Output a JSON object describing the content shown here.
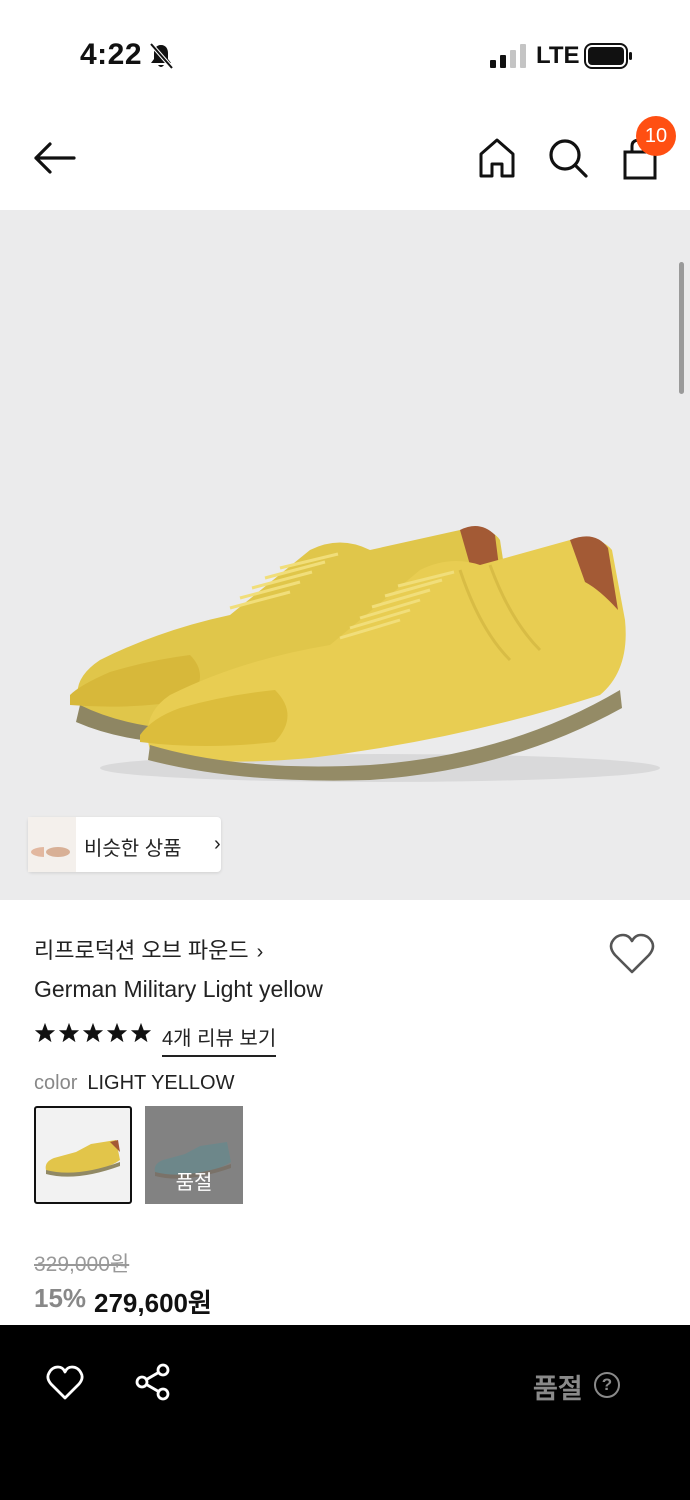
{
  "status_bar": {
    "time": "4:22",
    "network": "LTE",
    "icons": [
      "bell-off-icon",
      "signal-icon",
      "battery-icon"
    ]
  },
  "header": {
    "icons": [
      "back-arrow-icon",
      "home-icon",
      "search-icon",
      "shopping-bag-icon"
    ],
    "cart_count": "10",
    "accent_color": "#ff4f12"
  },
  "gallery": {
    "similar_products_label": "비슷한 상품",
    "similar_chevron": "›"
  },
  "product": {
    "brand": "리프로덕션 오브 파운드",
    "brand_chevron": "›",
    "name": "German Military Light yellow",
    "rating_stars": 5,
    "review_link": "4개 리뷰 보기",
    "color_label": "color",
    "color_value": "LIGHT YELLOW",
    "swatches": [
      {
        "name": "light-yellow",
        "selected": true,
        "soldout": false
      },
      {
        "name": "teal",
        "selected": false,
        "soldout": true,
        "soldout_label": "품절"
      }
    ],
    "original_price": "329,000원",
    "discount": "15%",
    "sale_price": "279,600원"
  },
  "bottom_bar": {
    "icons": [
      "heart-icon",
      "share-icon",
      "help-icon"
    ],
    "status_label": "품절",
    "help_symbol": "?"
  }
}
